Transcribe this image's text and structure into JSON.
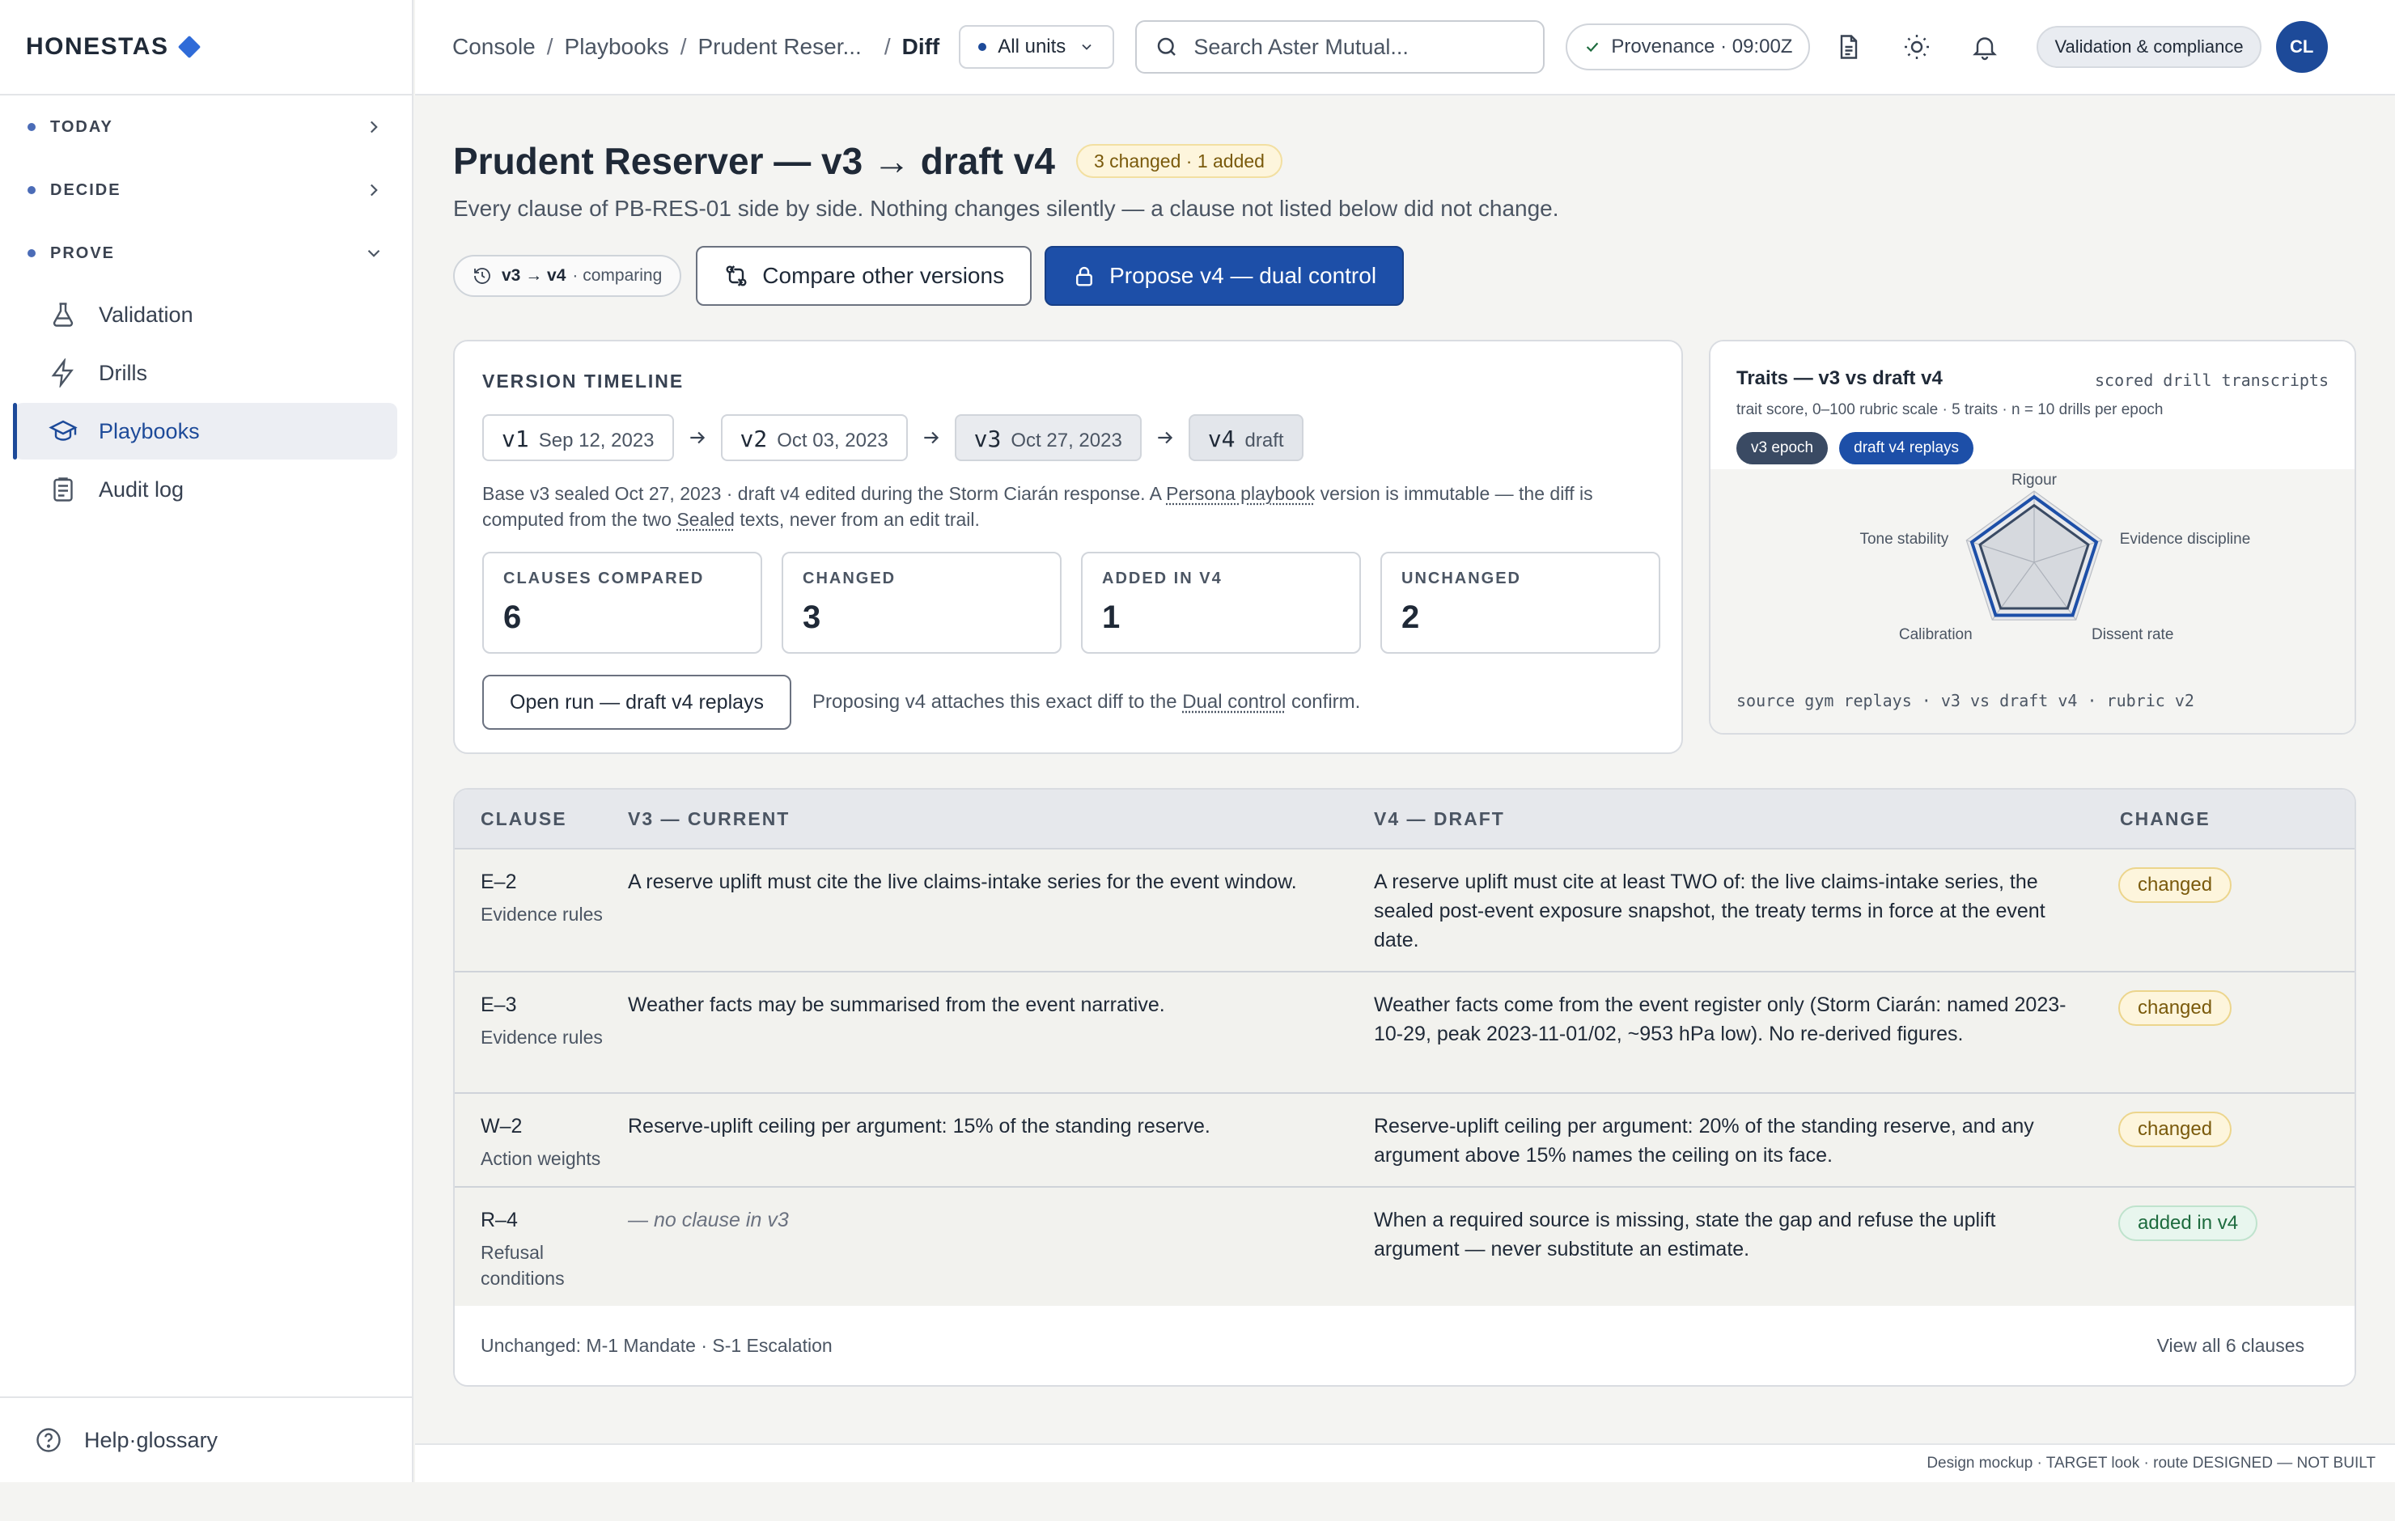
{
  "brand": {
    "name": "HONESTAS"
  },
  "sidebar": {
    "groups": [
      {
        "label": "TODAY"
      },
      {
        "label": "DECIDE"
      },
      {
        "label": "PROVE"
      }
    ],
    "items": [
      {
        "label": "Validation",
        "icon": "flask-icon"
      },
      {
        "label": "Drills",
        "icon": "bolt-icon"
      },
      {
        "label": "Playbooks",
        "icon": "graduation-cap-icon",
        "active": true
      },
      {
        "label": "Audit log",
        "icon": "clipboard-icon"
      }
    ],
    "footer": {
      "label": "Help·glossary",
      "icon": "help-circle-icon"
    }
  },
  "topbar": {
    "breadcrumbs": [
      "Console",
      "Playbooks",
      "Prudent Reser...",
      "Diff"
    ],
    "unit_select": "All units",
    "search_placeholder": "Search Aster Mutual...",
    "provenance": "Provenance · 09:00Z",
    "compliance_pill": "Validation & compliance",
    "avatar_initials": "CL"
  },
  "header": {
    "title": "Prudent Reserver — v3 → draft v4",
    "badge": "3 changed · 1 added",
    "subtitle": "Every clause of PB-RES-01 side by side. Nothing changes silently — a clause not listed below did not change.",
    "compare_chip": {
      "versions": "v3 → v4",
      "note": "· comparing"
    },
    "compare_button": "Compare other versions",
    "propose_button": "Propose v4 — dual control"
  },
  "version_card": {
    "heading": "VERSION TIMELINE",
    "versions": [
      {
        "name": "v1",
        "date": "Sep 12, 2023"
      },
      {
        "name": "v2",
        "date": "Oct 03, 2023"
      },
      {
        "name": "v3",
        "date": "Oct 27, 2023"
      },
      {
        "name": "v4",
        "date": "draft"
      }
    ],
    "desc_a": "Base v3 sealed Oct 27, 2023 · draft v4 edited during the Storm Ciarán response. A ",
    "desc_link1": "Persona playbook",
    "desc_b": " version is immutable — the diff is computed from the two ",
    "desc_link2": "Sealed",
    "desc_c": " texts, never from an edit trail.",
    "stats": [
      {
        "label": "CLAUSES COMPARED",
        "value": "6"
      },
      {
        "label": "CHANGED",
        "value": "3"
      },
      {
        "label": "ADDED IN V4",
        "value": "1"
      },
      {
        "label": "UNCHANGED",
        "value": "2"
      }
    ],
    "open_run_button": "Open run — draft v4 replays",
    "foot_a": "Proposing v4 attaches this exact diff to the ",
    "foot_link": "Dual control",
    "foot_b": " confirm."
  },
  "traits": {
    "title": "Traits — v3 vs draft v4",
    "side": "scored drill transcripts",
    "subtitle": "trait score, 0–100 rubric scale · 5 traits · n = 10 drills per epoch",
    "legend": [
      "v3 epoch",
      "draft v4 replays"
    ],
    "source": "source gym replays · v3 vs draft v4 · rubric v2",
    "colors": {
      "v3": "#3a4a63",
      "v4": "#1d4fa8"
    }
  },
  "chart_data": {
    "type": "radar",
    "categories": [
      "Rigour",
      "Evidence discipline",
      "Dissent rate",
      "Calibration",
      "Tone stability"
    ],
    "series": [
      {
        "name": "v3 epoch",
        "values": [
          80,
          80,
          80,
          80,
          80
        ]
      },
      {
        "name": "draft v4 replays",
        "values": [
          92,
          92,
          92,
          92,
          92
        ]
      }
    ],
    "ylim": [
      0,
      100
    ],
    "title": "Traits — v3 vs draft v4"
  },
  "table": {
    "headers": [
      "CLAUSE",
      "V3 — CURRENT",
      "V4 — DRAFT",
      "CHANGE"
    ],
    "rows": [
      {
        "code": "E–2",
        "category": "Evidence rules",
        "v3": "A reserve uplift must cite the live claims-intake series for the event window.",
        "v4": "A reserve uplift must cite at least TWO of: the live claims-intake series, the sealed post-event exposure snapshot, the treaty terms in force at the event date.",
        "change": "changed"
      },
      {
        "code": "E–3",
        "category": "Evidence rules",
        "v3": "Weather facts may be summarised from the event narrative.",
        "v4": "Weather facts come from the event register only (Storm Ciarán: named 2023-10-29, peak 2023-11-01/02, ~953 hPa low). No re-derived figures.",
        "change": "changed"
      },
      {
        "code": "W–2",
        "category": "Action weights",
        "v3": "Reserve-uplift ceiling per argument: 15% of the standing reserve.",
        "v4": "Reserve-uplift ceiling per argument: 20% of the standing reserve, and any argument above 15% names the ceiling on its face.",
        "change": "changed"
      },
      {
        "code": "R–4",
        "category": "Refusal conditions",
        "v3": "— no clause in v3",
        "v4": "When a required source is missing, state the gap and refuse the uplift argument — never substitute an estimate.",
        "change": "added in v4"
      }
    ],
    "footer_left": "Unchanged: M-1 Mandate · S-1 Escalation",
    "footer_right": "View all 6 clauses"
  },
  "mock_note": "Design mockup · TARGET look · route DESIGNED — NOT BUILT"
}
